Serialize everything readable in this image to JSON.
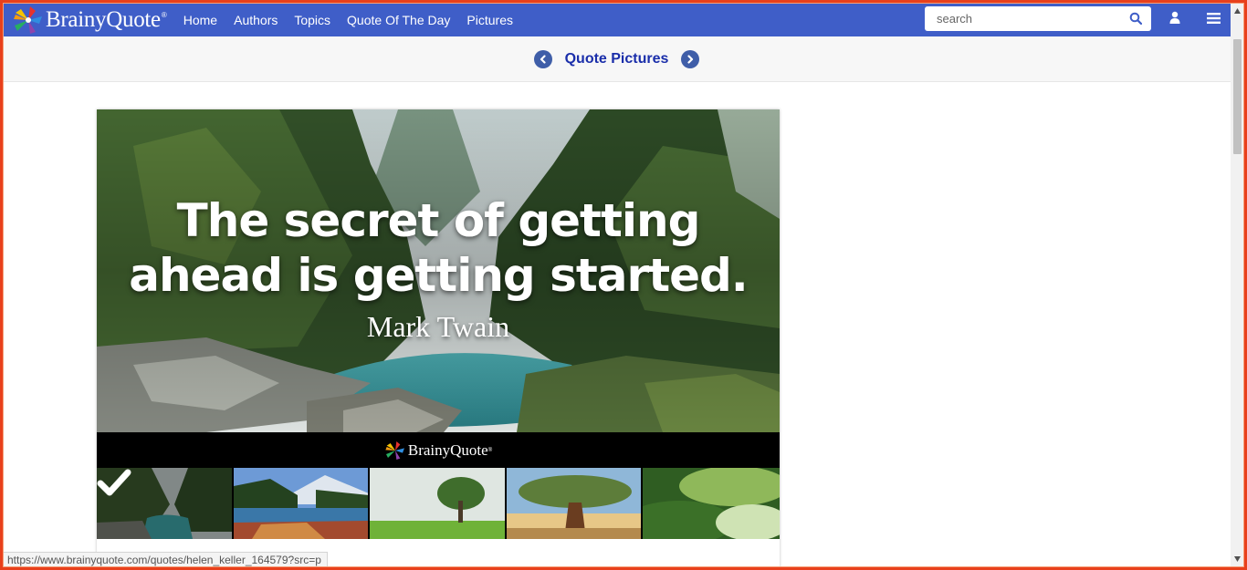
{
  "header": {
    "brand": "BrainyQuote",
    "brand_mark": "®",
    "nav": [
      "Home",
      "Authors",
      "Topics",
      "Quote Of The Day",
      "Pictures"
    ],
    "search_placeholder": "search",
    "icons": [
      "search-icon",
      "user-icon",
      "hamburger-menu-icon"
    ],
    "accent": "#3f5ec8"
  },
  "subheader": {
    "title": "Quote Pictures",
    "prev_icon": "chevron-left-circle-icon",
    "next_icon": "chevron-right-circle-icon"
  },
  "quote": {
    "text_line1": "The secret of getting",
    "text_line2": "ahead is getting started.",
    "author": "Mark Twain",
    "watermark": "BrainyQuote",
    "watermark_mark": "®"
  },
  "thumbnails": [
    {
      "name": "river-forest",
      "selected": true
    },
    {
      "name": "mountain-lake",
      "selected": false
    },
    {
      "name": "lone-tree-field",
      "selected": false
    },
    {
      "name": "big-tree-sky",
      "selected": false
    },
    {
      "name": "green-meadow",
      "selected": false
    }
  ],
  "status_bar": {
    "url": "https://www.brainyquote.com/quotes/helen_keller_164579?src=p"
  },
  "frame_color": "#e8401c"
}
